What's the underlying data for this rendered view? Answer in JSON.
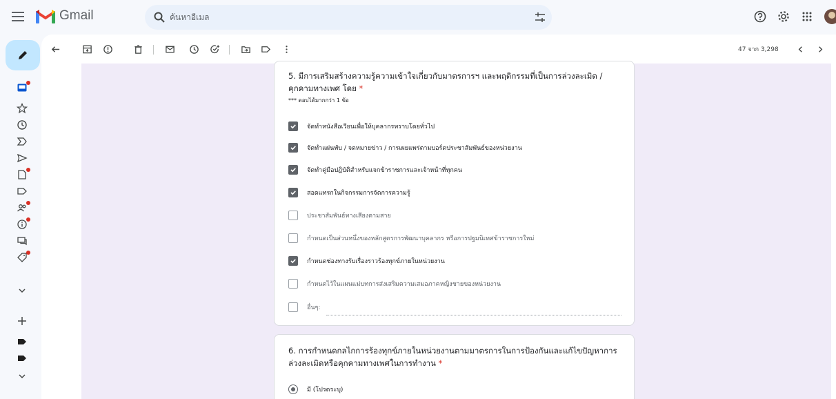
{
  "header": {
    "app_name": "Gmail",
    "search_placeholder": "ค้นหาอีเมล"
  },
  "left_rail": {
    "icons": [
      "inbox-icon",
      "star-icon",
      "snoozed-icon",
      "important-icon",
      "sent-icon",
      "drafts-icon",
      "label-icon",
      "social-icon",
      "updates-icon",
      "forums-icon",
      "promotions-icon",
      "more-icon",
      "add-label-icon",
      "label-icon",
      "label-icon",
      "more-icon"
    ]
  },
  "toolbar": {
    "pager_text": "47 จาก 3,298"
  },
  "question5": {
    "title": "5. มีการเสริมสร้างความรู้ความเข้าใจเกี่ยวกับมาตรการฯ และพฤติกรรมที่เป็นการล่วงละเมิด / คุกคามทางเพศ โดย",
    "required_mark": "*",
    "note": "*** ตอบได้มากกว่า 1 ข้อ",
    "options": [
      {
        "label": "จัดทำหนังสือเวียนเพื่อให้บุคลากรทราบโดยทั่วไป",
        "checked": true
      },
      {
        "label": "จัดทำแผ่นพับ / จดหมายข่าว / การเผยแพร่ตามบอร์ดประชาสัมพันธ์ของหน่วยงาน",
        "checked": true
      },
      {
        "label": "จัดทำคู่มือปฏิบัติสำหรับแจกข้าราชการและเจ้าหน้าที่ทุกคน",
        "checked": true
      },
      {
        "label": "สอดแทรกในกิจกรรมการจัดการความรู้",
        "checked": true
      },
      {
        "label": "ประชาสัมพันธ์ทางเสียงตามสาย",
        "checked": false
      },
      {
        "label": "กำหนดเป็นส่วนหนึ่งของหลักสูตรการพัฒนาบุคลากร หรือการปฐมนิเทศข้าราชการใหม่",
        "checked": false
      },
      {
        "label": "กำหนดช่องทางรับเรื่องราวร้องทุกข์ภายในหน่วยงาน",
        "checked": true
      },
      {
        "label": "กำหนดไว้ในแผนแม่บทการส่งเสริมความเสมอภาคหญิงชายของหน่วยงาน",
        "checked": false
      },
      {
        "label": "อื่นๆ:",
        "checked": false
      }
    ]
  },
  "question6": {
    "title": "6. การกำหนดกลไกการร้องทุกข์ภายในหน่วยงานตามมาตรการในการป้องกันและแก้ไขปัญหาการล่วงละเมิดหรือคุกคามทางเพศในการทำงาน",
    "required_mark": "*",
    "options": [
      {
        "label": "มี (โปรดระบุ)",
        "selected": true
      }
    ]
  }
}
